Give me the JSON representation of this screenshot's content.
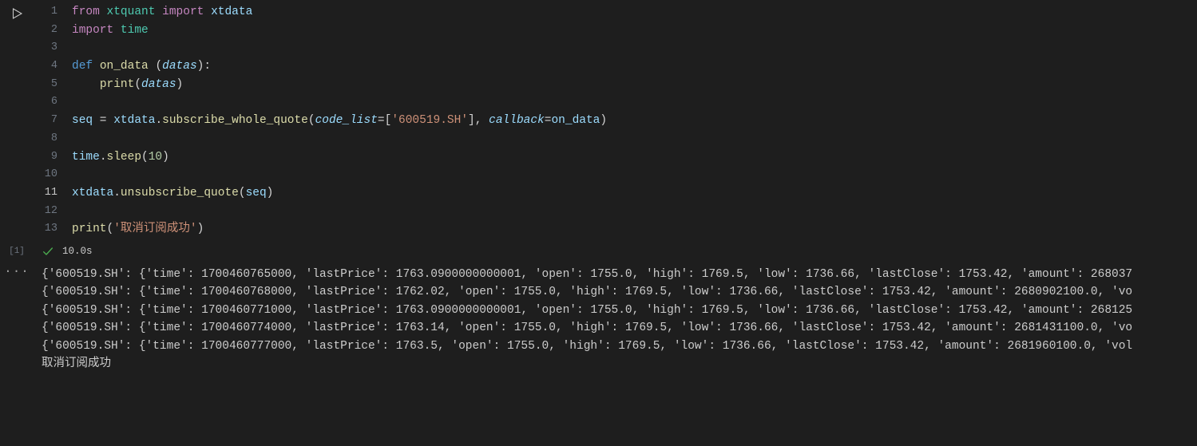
{
  "cell": {
    "execution_count_label": "[1]",
    "status": {
      "success": true,
      "duration": "10.0s"
    }
  },
  "code": {
    "line_count": 13,
    "current_line": 11,
    "tokens": {
      "l1": {
        "from": "from",
        "xtquant": "xtquant",
        "import": "import",
        "xtdata": "xtdata"
      },
      "l2": {
        "import": "import",
        "time": "time"
      },
      "l4": {
        "def": "def",
        "on_data": "on_data",
        "datas": "datas"
      },
      "l5": {
        "print": "print",
        "datas": "datas"
      },
      "l7": {
        "seq": "seq",
        "eq": " = ",
        "xtdata": "xtdata",
        "subscribe_whole_quote": "subscribe_whole_quote",
        "code_list": "code_list",
        "s600519": "'600519.SH'",
        "callback": "callback",
        "on_data": "on_data"
      },
      "l9": {
        "time": "time",
        "sleep": "sleep",
        "ten": "10"
      },
      "l11": {
        "xtdata": "xtdata",
        "unsubscribe_quote": "unsubscribe_quote",
        "seq": "seq"
      },
      "l13": {
        "print": "print",
        "msg": "'取消订阅成功'"
      }
    }
  },
  "output": {
    "lines": [
      "{'600519.SH': {'time': 1700460765000, 'lastPrice': 1763.0900000000001, 'open': 1755.0, 'high': 1769.5, 'low': 1736.66, 'lastClose': 1753.42, 'amount': 268037",
      "{'600519.SH': {'time': 1700460768000, 'lastPrice': 1762.02, 'open': 1755.0, 'high': 1769.5, 'low': 1736.66, 'lastClose': 1753.42, 'amount': 2680902100.0, 'vo",
      "{'600519.SH': {'time': 1700460771000, 'lastPrice': 1763.0900000000001, 'open': 1755.0, 'high': 1769.5, 'low': 1736.66, 'lastClose': 1753.42, 'amount': 268125",
      "{'600519.SH': {'time': 1700460774000, 'lastPrice': 1763.14, 'open': 1755.0, 'high': 1769.5, 'low': 1736.66, 'lastClose': 1753.42, 'amount': 2681431100.0, 'vo",
      "{'600519.SH': {'time': 1700460777000, 'lastPrice': 1763.5, 'open': 1755.0, 'high': 1769.5, 'low': 1736.66, 'lastClose': 1753.42, 'amount': 2681960100.0, 'vol",
      "取消订阅成功"
    ]
  }
}
